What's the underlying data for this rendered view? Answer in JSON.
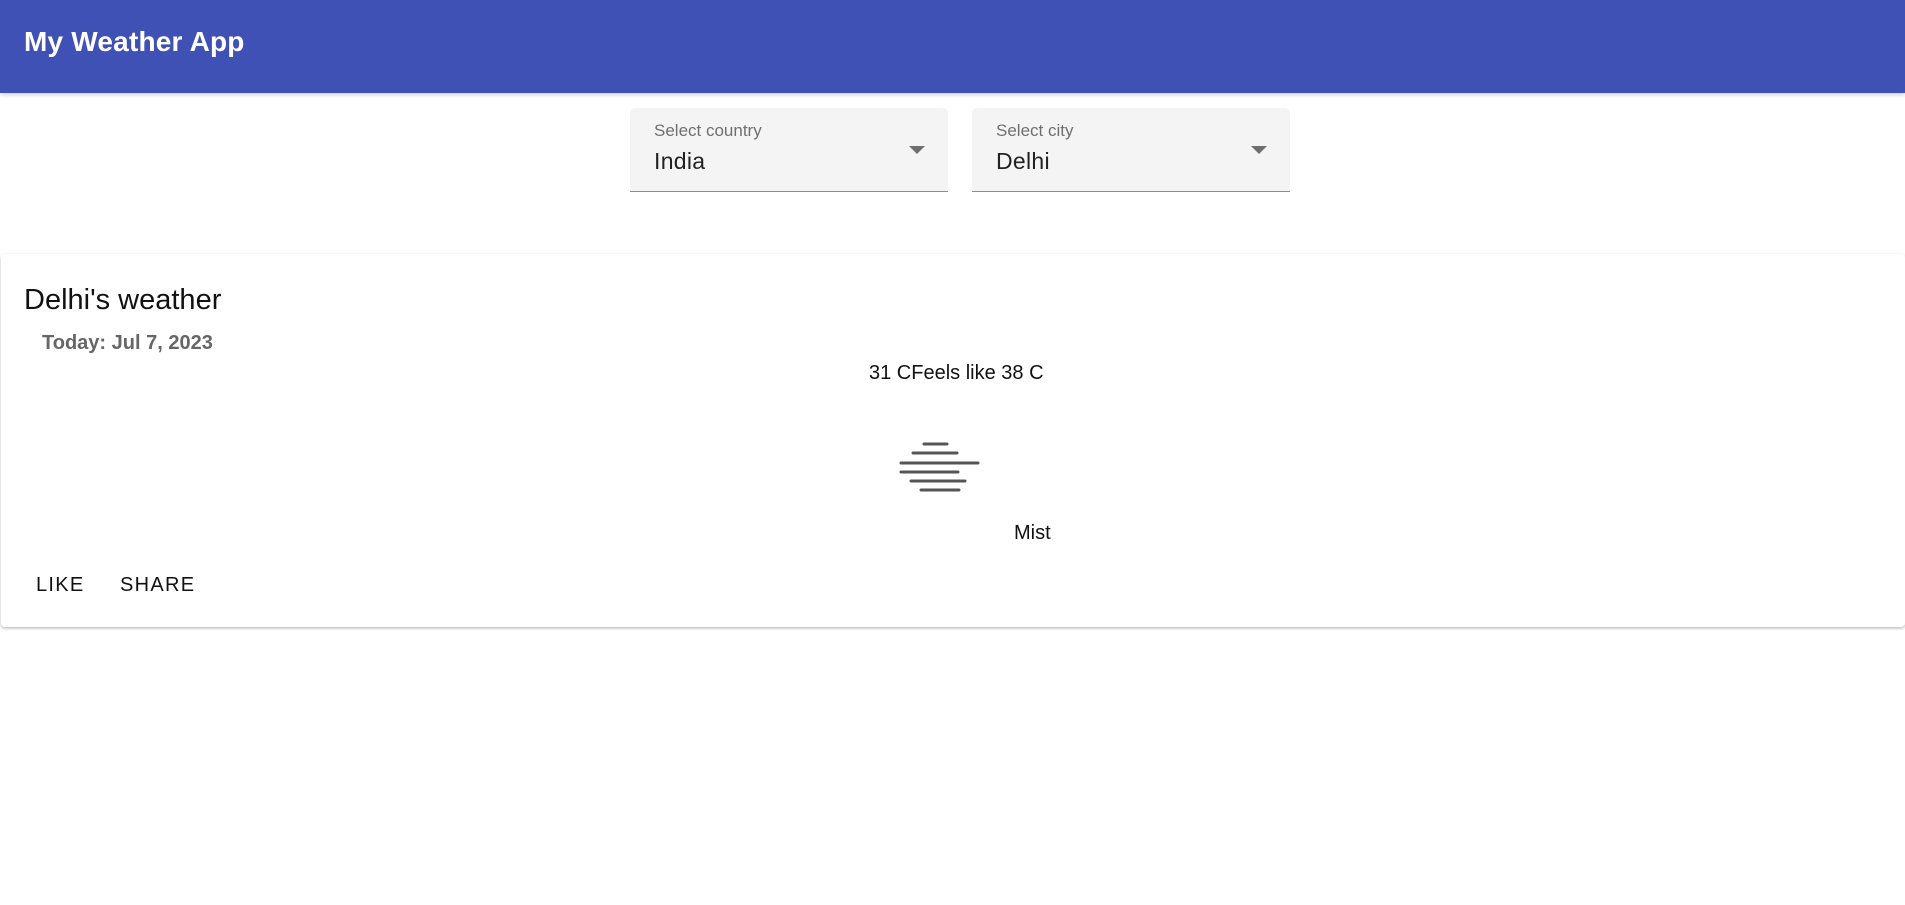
{
  "appbar": {
    "title": "My Weather App"
  },
  "filters": {
    "country": {
      "label": "Select country",
      "value": "India"
    },
    "city": {
      "label": "Select city",
      "value": "Delhi"
    }
  },
  "weather": {
    "title": "Delhi's weather",
    "date": "Today: Jul 7, 2023",
    "temperature_text": "31 CFeels like 38 C",
    "condition": "Mist",
    "icon": "mist-icon"
  },
  "actions": {
    "like": "LIKE",
    "share": "SHARE"
  },
  "colors": {
    "appbar": "#3f51b5",
    "select_background": "#f4f4f4"
  }
}
